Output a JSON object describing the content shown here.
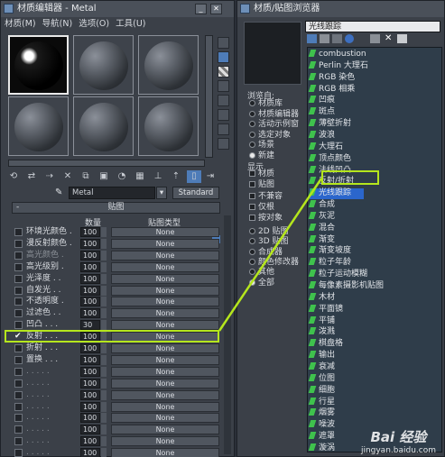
{
  "left_window": {
    "title": "材质编辑器 - Metal",
    "menu": [
      "材质(M)",
      "导航(N)",
      "选项(O)",
      "工具(U)"
    ],
    "material_name": "Metal",
    "material_type": "Standard",
    "maps_rollout": {
      "collapse_sign": "-",
      "title": "贴图",
      "col_amount": "数量",
      "col_map_type": "贴图类型",
      "rows": [
        {
          "name": "环境光颜色 .",
          "amount": "100",
          "map": "None",
          "dim": false
        },
        {
          "name": "漫反射颜色 .",
          "amount": "100",
          "map": "None",
          "dim": false
        },
        {
          "name": "高光颜色 .",
          "amount": "100",
          "map": "None",
          "dim": true
        },
        {
          "name": "高光级别 .",
          "amount": "100",
          "map": "None",
          "dim": false
        },
        {
          "name": "光泽度 . .",
          "amount": "100",
          "map": "None",
          "dim": false
        },
        {
          "name": "自发光 . .",
          "amount": "100",
          "map": "None",
          "dim": false
        },
        {
          "name": "不透明度 .",
          "amount": "100",
          "map": "None",
          "dim": false
        },
        {
          "name": "过滤色 . .",
          "amount": "100",
          "map": "None",
          "dim": false
        },
        {
          "name": "凹凸 . . .",
          "amount": "30",
          "map": "None",
          "dim": false
        },
        {
          "name": "反射 . . .",
          "amount": "100",
          "map": "None",
          "dim": false,
          "checked": true
        },
        {
          "name": "折射 . . .",
          "amount": "100",
          "map": "None",
          "dim": false
        },
        {
          "name": "置换 . . .",
          "amount": "100",
          "map": "None",
          "dim": false
        },
        {
          "name": ". . . . .",
          "amount": "100",
          "map": "None",
          "dim": true
        },
        {
          "name": ". . . . .",
          "amount": "100",
          "map": "None",
          "dim": true
        },
        {
          "name": ". . . . .",
          "amount": "100",
          "map": "None",
          "dim": true
        },
        {
          "name": ". . . . .",
          "amount": "100",
          "map": "None",
          "dim": true
        },
        {
          "name": ". . . . .",
          "amount": "100",
          "map": "None",
          "dim": true
        },
        {
          "name": ". . . . .",
          "amount": "100",
          "map": "None",
          "dim": true
        },
        {
          "name": ". . . . .",
          "amount": "100",
          "map": "None",
          "dim": true
        },
        {
          "name": ". . . . .",
          "amount": "100",
          "map": "None",
          "dim": true
        }
      ]
    }
  },
  "right_window": {
    "title": "材质/贴图浏览器",
    "search_value": "光线跟踪",
    "browse_from": {
      "label": "浏览自:",
      "options": [
        "材质库",
        "材质编辑器",
        "活动示例窗",
        "选定对象",
        "场景",
        "新建"
      ],
      "selected": "新建"
    },
    "show": {
      "label": "显示",
      "options": [
        "材质",
        "贴图",
        "不兼容",
        "仅根",
        "按对象"
      ]
    },
    "filter": {
      "options": [
        "2D 贴图",
        "3D 贴图",
        "合成器",
        "颜色修改器",
        "其他",
        "全部"
      ],
      "selected": "全部"
    },
    "map_list": [
      "combustion",
      "Perlin 大理石",
      "RGB 染色",
      "RGB 相乘",
      "凹痕",
      "斑点",
      "薄壁折射",
      "波浪",
      "大理石",
      "顶点颜色",
      "法线凹凸",
      "反射/折射",
      "光线跟踪",
      "合成",
      "灰泥",
      "混合",
      "渐变",
      "渐变坡度",
      "粒子年龄",
      "粒子运动模糊",
      "每像素摄影机贴图",
      "木材",
      "平面镜",
      "平铺",
      "泼溅",
      "棋盘格",
      "输出",
      "衰减",
      "位图",
      "细胞",
      "行星",
      "烟雾",
      "噪波",
      "遮罩",
      "漩涡"
    ],
    "selected_item": "光线跟踪"
  },
  "watermark": {
    "brand": "Bai 经验",
    "url": "jingyan.baidu.com"
  },
  "colors": {
    "highlight": "#b5e61d",
    "selection": "#2b66cc",
    "map_icon": "#3fc24d"
  }
}
